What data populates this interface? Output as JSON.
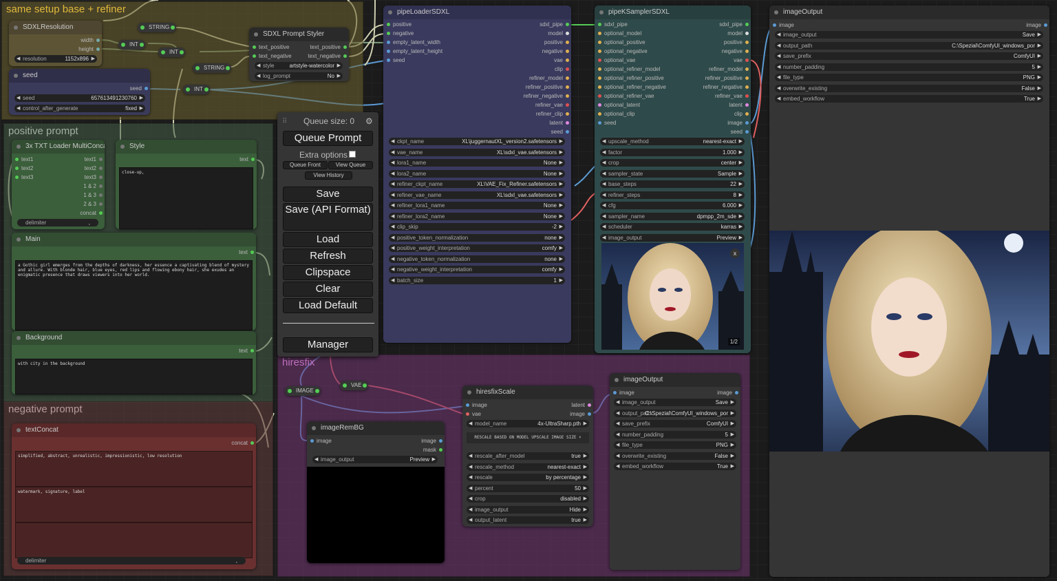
{
  "groups": {
    "setup": {
      "title": "same setup base + refiner",
      "color": "#665c33"
    },
    "positive": {
      "title": "positive prompt",
      "color": "#3f5140"
    },
    "negative": {
      "title": "negative prompt",
      "color": "#5a3c3c"
    },
    "hiresfix": {
      "title": "hiresfix",
      "color": "#6a3a6a"
    }
  },
  "reroutes": {
    "string1": "STRING",
    "int1": "INT",
    "int2": "INT",
    "string2": "STRING",
    "int3": "INT",
    "image": "IMAGE",
    "vae": "VAE"
  },
  "sdxlres": {
    "title": "SDXLResolution",
    "outputs": [
      "width",
      "height"
    ],
    "resolution": {
      "label": "resolution",
      "value": "1152x896"
    }
  },
  "seed": {
    "title": "seed",
    "output": "seed",
    "widgets": [
      {
        "label": "seed",
        "value": "657613491230760"
      },
      {
        "label": "control_after_generate",
        "value": "fixed"
      }
    ]
  },
  "styler": {
    "title": "SDXL Prompt Styler",
    "inputs": [
      "text_positive",
      "text_negative"
    ],
    "outputs": [
      "text_positive",
      "text_negative"
    ],
    "widgets": [
      {
        "label": "style",
        "value": "artstyle-watercolor"
      },
      {
        "label": "log_prompt",
        "value": "No"
      }
    ]
  },
  "txtloader": {
    "title": "3x TXT Loader MultiConcat",
    "inputs": [
      "text1",
      "text2",
      "text3"
    ],
    "outputs": [
      "text1",
      "text2",
      "text3",
      "1 & 2",
      "1 & 3",
      "2 & 3",
      "concat"
    ],
    "delimiter": {
      "label": "delimiter",
      "value": ","
    }
  },
  "style": {
    "title": "Style",
    "output": "text",
    "text": "close-up,"
  },
  "main": {
    "title": "Main",
    "output": "text",
    "text": "a Gothic girl emerges from the depths of darkness, her essence a captivating blend of mystery and allure. With blonde hair, blue eyes, red lips and flowing ebony hair, she exudes an enigmatic presence that draws viewers into her world."
  },
  "background": {
    "title": "Background",
    "output": "text",
    "text": "with city in the background"
  },
  "textconcat": {
    "title": "textConcat",
    "output": "concat",
    "texts": [
      "simplified, abstract, unrealistic, impressionistic, low resolution",
      "watermark, signature, label",
      ""
    ],
    "delimiter": {
      "label": "delimiter",
      "value": ","
    }
  },
  "menu": {
    "queue_size": "Queue size: 0",
    "queue_prompt": "Queue Prompt",
    "extra_options": "Extra options",
    "queue_front": "Queue Front",
    "view_queue": "View Queue",
    "view_history": "View History",
    "save": "Save",
    "save_api": "Save (API Format)",
    "load": "Load",
    "refresh": "Refresh",
    "clipspace": "Clipspace",
    "clear": "Clear",
    "load_default": "Load Default",
    "manager": "Manager"
  },
  "pipeloader": {
    "title": "pipeLoaderSDXL",
    "inputs": [
      "positive",
      "negative",
      "empty_latent_width",
      "empty_latent_height",
      "seed"
    ],
    "outputs": [
      "sdxl_pipe",
      "model",
      "positive",
      "negative",
      "vae",
      "clip",
      "refiner_model",
      "refiner_positive",
      "refiner_negative",
      "refiner_vae",
      "refiner_clip",
      "latent",
      "seed"
    ],
    "widgets": [
      {
        "label": "ckpt_name",
        "value": "XL\\juggernautXL_version2.safetensors"
      },
      {
        "label": "vae_name",
        "value": "XL\\sdxl_vae.safetensors"
      },
      {
        "label": "lora1_name",
        "value": "None"
      },
      {
        "label": "lora2_name",
        "value": "None"
      },
      {
        "label": "refiner_ckpt_name",
        "value": "XL\\VAE_Fix_Refiner.safetensors"
      },
      {
        "label": "refiner_vae_name",
        "value": "XL\\sdxl_vae.safetensors"
      },
      {
        "label": "refiner_lora1_name",
        "value": "None"
      },
      {
        "label": "refiner_lora2_name",
        "value": "None"
      },
      {
        "label": "clip_skip",
        "value": "-2"
      },
      {
        "label": "positive_token_normalization",
        "value": "none"
      },
      {
        "label": "positive_weight_interpretation",
        "value": "comfy"
      },
      {
        "label": "negative_token_normalization",
        "value": "none"
      },
      {
        "label": "negative_weight_interpretation",
        "value": "comfy"
      },
      {
        "label": "batch_size",
        "value": "1"
      }
    ]
  },
  "ksampler": {
    "title": "pipeKSamplerSDXL",
    "inputs": [
      "sdxl_pipe",
      "optional_model",
      "optional_positive",
      "optional_negative",
      "optional_vae",
      "optional_refiner_model",
      "optional_refiner_positive",
      "optional_refiner_negative",
      "optional_refiner_vae",
      "optional_latent",
      "optional_clip",
      "seed"
    ],
    "outputs": [
      "sdxl_pipe",
      "model",
      "positive",
      "negative",
      "vae",
      "refiner_model",
      "refiner_positive",
      "refiner_negative",
      "refiner_vae",
      "latent",
      "clip",
      "image",
      "seed"
    ],
    "widgets": [
      {
        "label": "upscale_method",
        "value": "nearest-exact"
      },
      {
        "label": "factor",
        "value": "1.000"
      },
      {
        "label": "crop",
        "value": "center"
      },
      {
        "label": "sampler_state",
        "value": "Sample"
      },
      {
        "label": "base_steps",
        "value": "22"
      },
      {
        "label": "refiner_steps",
        "value": "8"
      },
      {
        "label": "cfg",
        "value": "6.000"
      },
      {
        "label": "sampler_name",
        "value": "dpmpp_2m_sde"
      },
      {
        "label": "scheduler",
        "value": "karras"
      },
      {
        "label": "image_output",
        "value": "Preview"
      }
    ],
    "preview_counter": "1/2",
    "close": "x"
  },
  "imageoutput_top": {
    "title": "imageOutput",
    "input": "image",
    "output": "image",
    "widgets": [
      {
        "label": "image_output",
        "value": "Save"
      },
      {
        "label": "output_path",
        "value": "C:\\Spezial\\ComfyUI_windows_por"
      },
      {
        "label": "save_prefix",
        "value": "ComfyUI"
      },
      {
        "label": "number_padding",
        "value": "5"
      },
      {
        "label": "file_type",
        "value": "PNG"
      },
      {
        "label": "overwrite_existing",
        "value": "False"
      },
      {
        "label": "embed_workflow",
        "value": "True"
      }
    ]
  },
  "hiresscale": {
    "title": "hiresfixScale",
    "inputs": [
      "image",
      "vae"
    ],
    "outputs": [
      "latent",
      "image"
    ],
    "model_name": {
      "label": "model_name",
      "value": "4x-UltraSharp.pth"
    },
    "note": "RESCALE BASED ON MODEL UPSCALE IMAGE SIZE ⬇",
    "widgets": [
      {
        "label": "rescale_after_model",
        "value": "true"
      },
      {
        "label": "rescale_method",
        "value": "nearest-exact"
      },
      {
        "label": "rescale",
        "value": "by percentage"
      },
      {
        "label": "percent",
        "value": "50"
      },
      {
        "label": "crop",
        "value": "disabled"
      },
      {
        "label": "image_output",
        "value": "Hide"
      },
      {
        "label": "output_latent",
        "value": "true"
      }
    ]
  },
  "rembg": {
    "title": "imageRemBG",
    "input": "image",
    "outputs": [
      "image",
      "mask"
    ],
    "widget": {
      "label": "image_output",
      "value": "Preview"
    }
  },
  "imageoutput_mid": {
    "title": "imageOutput",
    "input": "image",
    "output": "image",
    "widgets": [
      {
        "label": "image_output",
        "value": "Save"
      },
      {
        "label": "output_path",
        "value": "C:\\Spezial\\ComfyUI_windows_por"
      },
      {
        "label": "save_prefix",
        "value": "ComfyUI"
      },
      {
        "label": "number_padding",
        "value": "5"
      },
      {
        "label": "file_type",
        "value": "PNG"
      },
      {
        "label": "overwrite_existing",
        "value": "False"
      },
      {
        "label": "embed_workflow",
        "value": "True"
      }
    ]
  },
  "colors": {
    "link_blue": "#5b9bd5",
    "link_red": "#e06060",
    "link_gray": "#cfcfb0",
    "link_green": "#5c5",
    "link_yellow": "#e0b050"
  }
}
